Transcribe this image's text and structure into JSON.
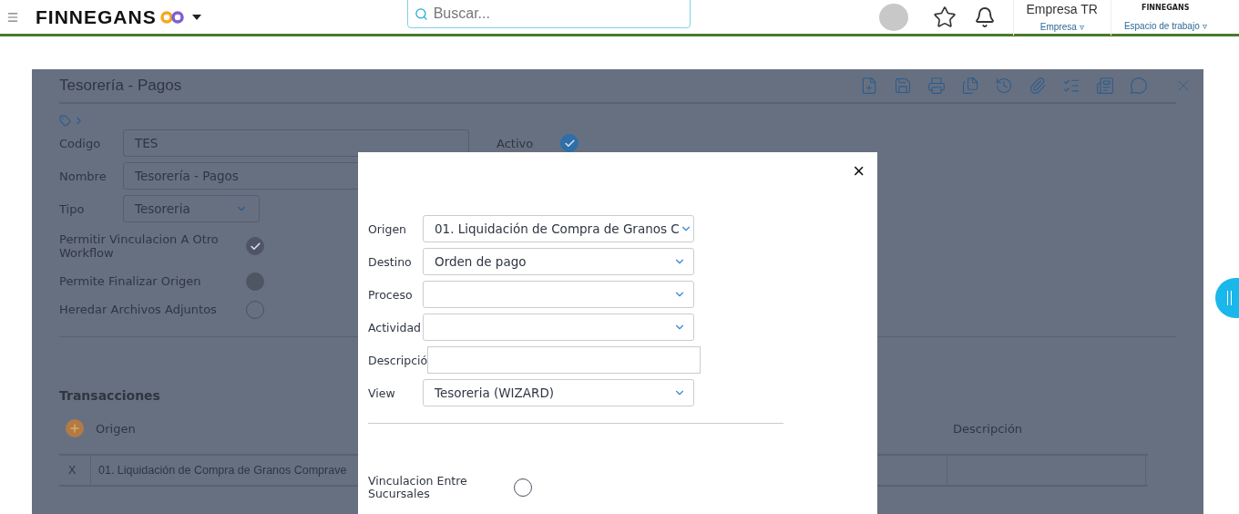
{
  "header": {
    "brand": "FINNEGANS",
    "search": {
      "placeholder": "Buscar..."
    },
    "company": {
      "name": "Empresa TR",
      "label": "Empresa",
      "caret": "▿"
    },
    "workspace": {
      "logo": "FINNEGANS",
      "label": "Espacio de trabajo",
      "caret": "▿"
    }
  },
  "form": {
    "title": "Tesorería - Pagos",
    "fields": [
      {
        "label": "Codigo",
        "value": "TES",
        "kind": "text"
      },
      {
        "label": "Nombre",
        "value": "Tesorería - Pagos",
        "kind": "text"
      },
      {
        "label": "Tipo",
        "value": "Tesoreria",
        "kind": "select"
      }
    ],
    "active": {
      "label": "Activo",
      "checked": true
    },
    "options": [
      {
        "label": "Permitir Vinculacion A Otro Workflow",
        "checked": true,
        "disabled": false
      },
      {
        "label": "Permite Finalizar Origen",
        "checked": false,
        "disabled": true
      },
      {
        "label": "Heredar Archivos Adjuntos",
        "checked": false,
        "disabled": false
      }
    ],
    "transactions": {
      "title": "Transacciones",
      "columns": [
        "Origen",
        "Descripción"
      ],
      "rows": [
        {
          "remove": "X",
          "origen": "01. Liquidación de Compra de Granos Comprave"
        }
      ]
    }
  },
  "modal": {
    "close": "×",
    "fields": [
      {
        "label": "Origen",
        "value": "01. Liquidación de Compra de Granos C",
        "kind": "select"
      },
      {
        "label": "Destino",
        "value": "Orden de pago",
        "kind": "select"
      },
      {
        "label": "Proceso",
        "kind": "select"
      },
      {
        "label": "Actividad",
        "kind": "select"
      },
      {
        "label": "Descripció",
        "kind": "text"
      },
      {
        "label": "View",
        "value": "Tesoreria (WIZARD)",
        "kind": "select"
      }
    ],
    "option": {
      "label": "Vinculacion Entre Sucursales",
      "checked": false
    }
  }
}
